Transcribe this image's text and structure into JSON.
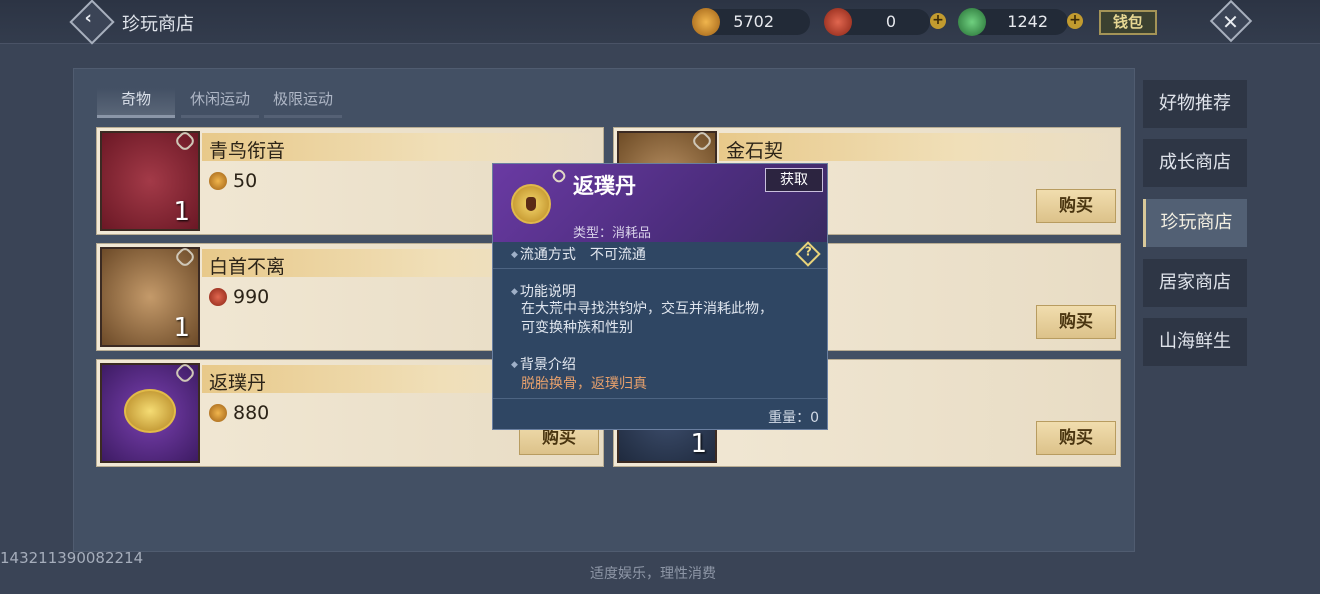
{
  "header": {
    "title": "珍玩商店",
    "currencies": [
      {
        "icon": "gold-coin-icon",
        "value": "5702",
        "color": "#c9892b"
      },
      {
        "icon": "red-orb-icon",
        "value": "0",
        "color": "#b23a2a"
      },
      {
        "icon": "jade-icon",
        "value": "1242",
        "color": "#3e9a55"
      }
    ],
    "wallet_label": "钱包"
  },
  "tabs": [
    "奇物",
    "休闲运动",
    "极限运动"
  ],
  "items": [
    {
      "name": "青鸟衔音",
      "price": "50",
      "qty": "1",
      "price_icon": "gold-coin-icon",
      "thumb_color": "#7a1f2d"
    },
    {
      "name": "金石契",
      "price": "",
      "qty": "",
      "price_icon": "",
      "thumb_color": "#8a6a3a",
      "buy": "购买"
    },
    {
      "name": "白首不离",
      "price": "990",
      "qty": "1",
      "price_icon": "red-orb-icon",
      "thumb_color": "#7a5a33"
    },
    {
      "name": "",
      "price": "",
      "qty": "",
      "price_icon": "",
      "thumb_color": "",
      "buy": "购买"
    },
    {
      "name": "返璞丹",
      "price": "880",
      "qty": "",
      "price_icon": "gold-coin-icon",
      "thumb_color": "#5b2a8a",
      "buy": "购买"
    },
    {
      "name": "",
      "price": "",
      "qty": "1",
      "price_icon": "",
      "thumb_color": "#2c3a52",
      "buy": "购买"
    }
  ],
  "side_nav": [
    "好物推荐",
    "成长商店",
    "珍玩商店",
    "居家商店",
    "山海鲜生"
  ],
  "popup": {
    "title": "返璞丹",
    "get_label": "获取",
    "type_text": "类型：消耗品",
    "circulation_label": "流通方式",
    "circulation_value": "不可流通",
    "func_label": "功能说明",
    "func_line1": "在大荒中寻找洪钧炉，交互并消耗此物，",
    "func_line2": "可变换种族和性别",
    "bg_label": "背景介绍",
    "bg_text": "脱胎换骨，返璞归真",
    "weight": "重量：0"
  },
  "footer": {
    "id": "143211390082214",
    "note": "适度娱乐，理性消费"
  }
}
